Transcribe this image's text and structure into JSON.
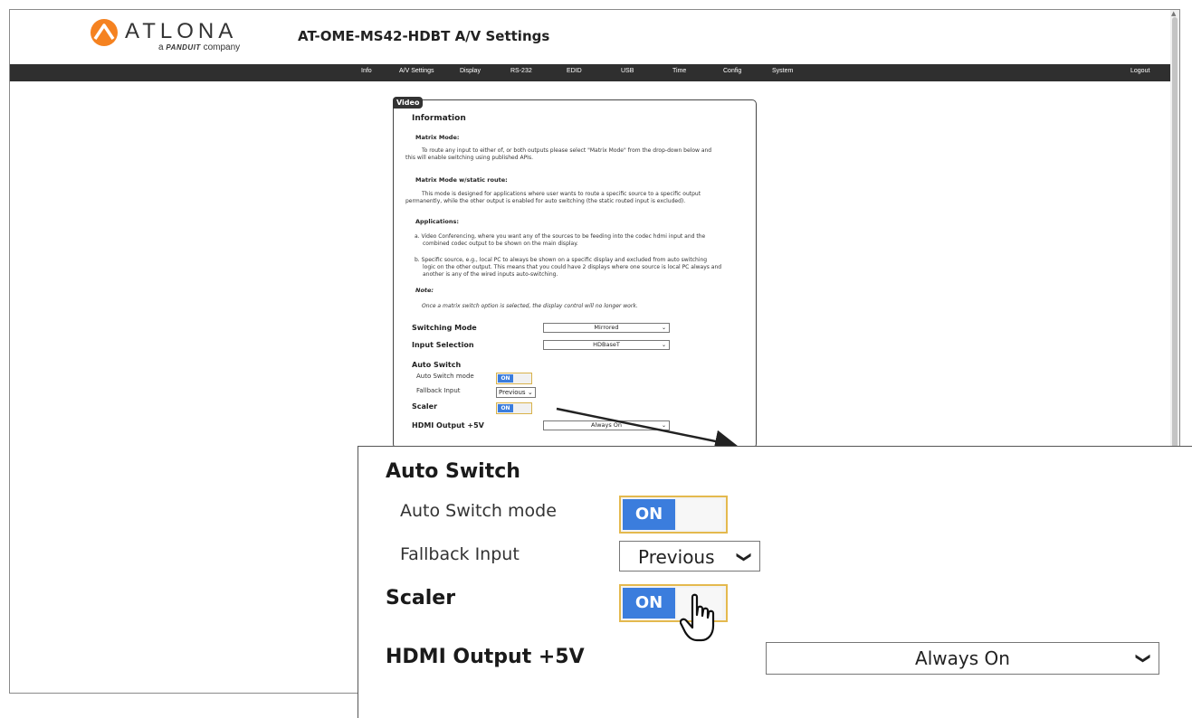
{
  "header": {
    "logo_text": "ATLONA",
    "logo_sub_prefix": "a",
    "logo_sub_brand": "PANDUIT",
    "logo_sub_suffix": "company",
    "page_title": "AT-OME-MS42-HDBT  A/V Settings"
  },
  "nav": {
    "items": [
      "Info",
      "A/V Settings",
      "Display",
      "RS-232",
      "EDID",
      "USB",
      "Time",
      "Config",
      "System"
    ],
    "logout": "Logout"
  },
  "panel": {
    "tag": "Video",
    "information": "Information",
    "matrix_mode_heading": "Matrix Mode:",
    "matrix_mode_text_1": "To route any input to either of, or both outputs please select \"Matrix Mode\" from the drop-down below and",
    "matrix_mode_text_2": "this will enable switching using published APIs.",
    "static_heading": "Matrix Mode w/static route:",
    "static_text_1": "This mode is designed for applications where user wants to route a specific source to a specific output",
    "static_text_2": "permanently, while the other output is enabled for auto switching (the static routed input is excluded).",
    "applications_heading": "Applications:",
    "app_a_1": "a.  Video Conferencing, where you want any of the sources to be feeding into the codec hdmi input and the",
    "app_a_2": "combined codec output to be shown on the main display.",
    "app_b_1": "b.  Specific source, e.g., local PC to always be shown on a specific display and excluded from auto switching",
    "app_b_2": "logic on the other output. This means that you could have 2 displays where one source is local PC always and",
    "app_b_3": "another is any of the wired inputs auto-switching.",
    "note_heading": "Note:",
    "note_text": "Once a matrix switch option is selected, the display control will no longer work.",
    "switching_mode_label": "Switching Mode",
    "switching_mode_value": "Mirrored",
    "input_selection_label": "Input Selection",
    "input_selection_value": "HDBaseT",
    "auto_switch_label": "Auto Switch",
    "auto_switch_mode_label": "Auto Switch mode",
    "auto_switch_mode_state": "ON",
    "fallback_label": "Fallback Input",
    "fallback_value": "Previous",
    "scaler_label": "Scaler",
    "scaler_state": "ON",
    "hdmi_label": "HDMI Output +5V",
    "hdmi_value": "Always On"
  },
  "zoom": {
    "auto_switch_label": "Auto Switch",
    "auto_switch_mode_label": "Auto Switch mode",
    "auto_switch_mode_state": "ON",
    "fallback_label": "Fallback Input",
    "fallback_value": "Previous",
    "scaler_label": "Scaler",
    "scaler_state": "ON",
    "hdmi_label": "HDMI Output +5V",
    "hdmi_value": "Always On"
  },
  "colors": {
    "logo_orange": "#f58220",
    "nav_bg": "#2f2f2f",
    "toggle_blue": "#3b7ddd",
    "toggle_border": "#e4b94e"
  },
  "icons": [
    "atlona-logo-icon",
    "chevron-down-icon",
    "hand-pointer-icon",
    "callout-arrow-icon"
  ]
}
